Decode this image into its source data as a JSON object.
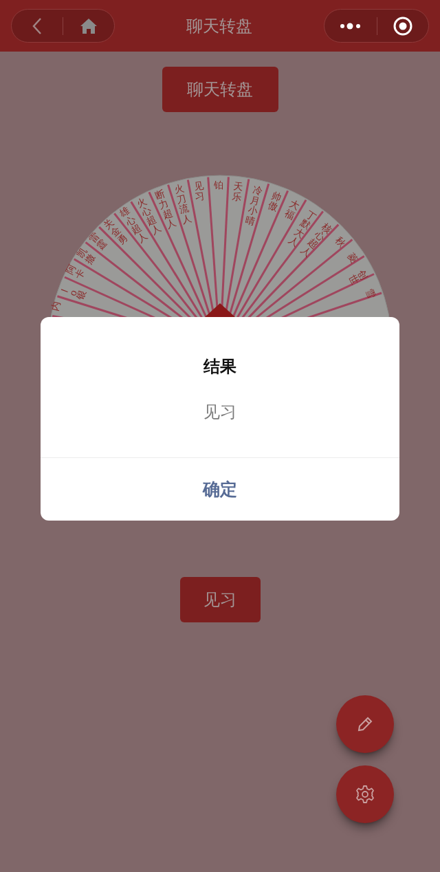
{
  "nav": {
    "title": "聊天转盘"
  },
  "title_button": "聊天转盘",
  "wheel": {
    "segments": [
      {
        "label": "内"
      },
      {
        "label": "lo银"
      },
      {
        "label": "阿卡"
      },
      {
        "label": "凯撒"
      },
      {
        "label": "雷霆"
      },
      {
        "label": "关金勇"
      },
      {
        "label": "雄心超人"
      },
      {
        "label": "火心超人"
      },
      {
        "label": "断力超人"
      },
      {
        "label": "火刀流人"
      },
      {
        "label": "见习"
      },
      {
        "label": "铂"
      },
      {
        "label": "天乐"
      },
      {
        "label": "冷月小晴"
      },
      {
        "label": "帅傲"
      },
      {
        "label": "大福"
      },
      {
        "label": "丁默大人"
      },
      {
        "label": "核心超人"
      },
      {
        "label": "秋"
      },
      {
        "label": "菱"
      },
      {
        "label": "创世"
      },
      {
        "label": "雪"
      }
    ]
  },
  "result_button": "见习",
  "dialog": {
    "title": "结果",
    "message": "见习",
    "confirm": "确定"
  },
  "fabs": [
    {
      "kind": "edit"
    },
    {
      "kind": "settings"
    }
  ]
}
